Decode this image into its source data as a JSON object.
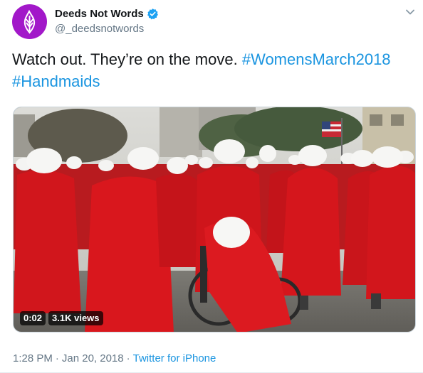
{
  "author": {
    "display_name": "Deeds Not Words",
    "handle": "@_deedsnotwords",
    "avatar_color": "#a218c9",
    "verified": true
  },
  "tweet": {
    "text_plain": "Watch out. They’re on the move.",
    "hashtags": [
      "#WomensMarch2018",
      "#Handmaids"
    ]
  },
  "video": {
    "duration": "0:02",
    "views": "3.1K views"
  },
  "meta": {
    "time": "1:28 PM",
    "separator_1": "·",
    "date": "Jan 20, 2018",
    "separator_2": "·",
    "source": "Twitter for iPhone"
  },
  "colors": {
    "link": "#1b95e0",
    "secondary_text": "#657786",
    "primary_text": "#14171a",
    "verified_badge": "#1da1f2",
    "cloak_red": "#d1161c"
  },
  "icons": {
    "verified": "verified-badge-icon",
    "caret": "chevron-down-icon",
    "avatar_logo": "flame-logo-icon"
  }
}
